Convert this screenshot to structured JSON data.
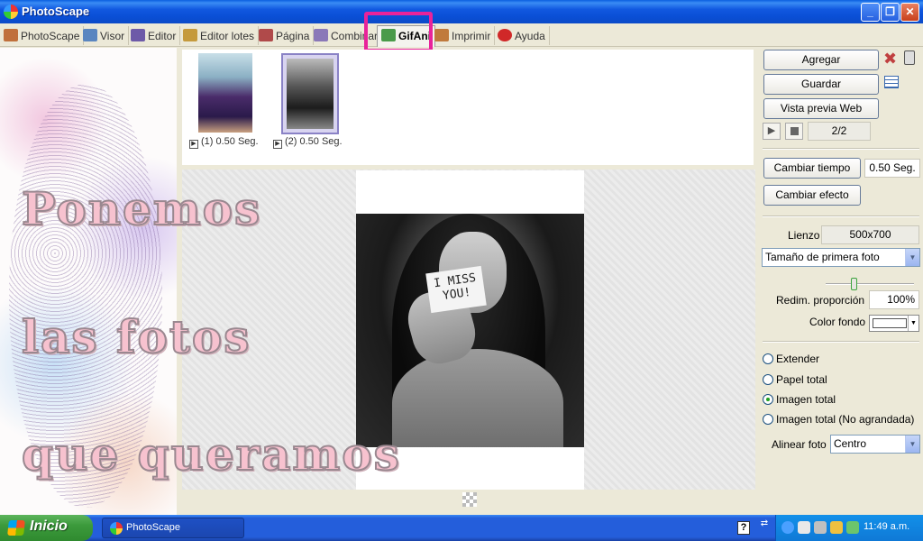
{
  "window": {
    "title": "PhotoScape",
    "min_label": "_",
    "max_label": "❐",
    "close_label": "✕"
  },
  "tabs": [
    {
      "label": "PhotoScape",
      "icon": "photoscape-icon",
      "color": "#c0703c"
    },
    {
      "label": "Visor",
      "icon": "viewer-icon",
      "color": "#5a86c0"
    },
    {
      "label": "Editor",
      "icon": "editor-icon",
      "color": "#6d5aa8"
    },
    {
      "label": "Editor lotes",
      "icon": "batch-editor-icon",
      "color": "#c59a3c"
    },
    {
      "label": "Página",
      "icon": "page-icon",
      "color": "#b04a4a"
    },
    {
      "label": "Combinar",
      "icon": "combine-icon",
      "color": "#8a78b8"
    },
    {
      "label": "GifAni",
      "icon": "gif-icon",
      "color": "#4a9a4a",
      "active": true
    },
    {
      "label": "Imprimir",
      "icon": "print-icon",
      "color": "#c07a3c"
    },
    {
      "label": "Ayuda",
      "icon": "help-icon",
      "color": "#d02828"
    }
  ],
  "overlay": {
    "line1": "Ponemos",
    "line2": "las fotos",
    "line3": "que queramos"
  },
  "frames": [
    {
      "label": "(1) 0.50 Seg."
    },
    {
      "label": "(2) 0.50 Seg."
    }
  ],
  "photo": {
    "note_line1": "I MISS",
    "note_line2": "YOU!"
  },
  "right": {
    "add_label": "Agregar",
    "save_label": "Guardar",
    "preview_label": "Vista previa Web",
    "frame_counter": "2/2",
    "change_time_label": "Cambiar tiempo",
    "time_value": "0.50 Seg.",
    "change_effect_label": "Cambiar efecto",
    "canvas_label": "Lienzo",
    "canvas_value": "500x700",
    "size_select": "Tamaño de primera foto",
    "resize_label": "Redim. proporción",
    "resize_value": "100%",
    "bg_color_label": "Color fondo",
    "bg_color": "#ffffff",
    "radio_options": [
      {
        "label": "Extender",
        "checked": false
      },
      {
        "label": "Papel total",
        "checked": false
      },
      {
        "label": "Imagen total",
        "checked": true
      },
      {
        "label": "Imagen total (No agrandada)",
        "checked": false
      }
    ],
    "align_label": "Alinear foto",
    "align_value": "Centro"
  },
  "taskbar": {
    "start_label": "Inicio",
    "task_label": "PhotoScape",
    "clock": "11:49 a.m."
  },
  "colors": {
    "highlight": "#e8239a",
    "titlebar": "#0a4fd6",
    "taskbar": "#245edb"
  }
}
